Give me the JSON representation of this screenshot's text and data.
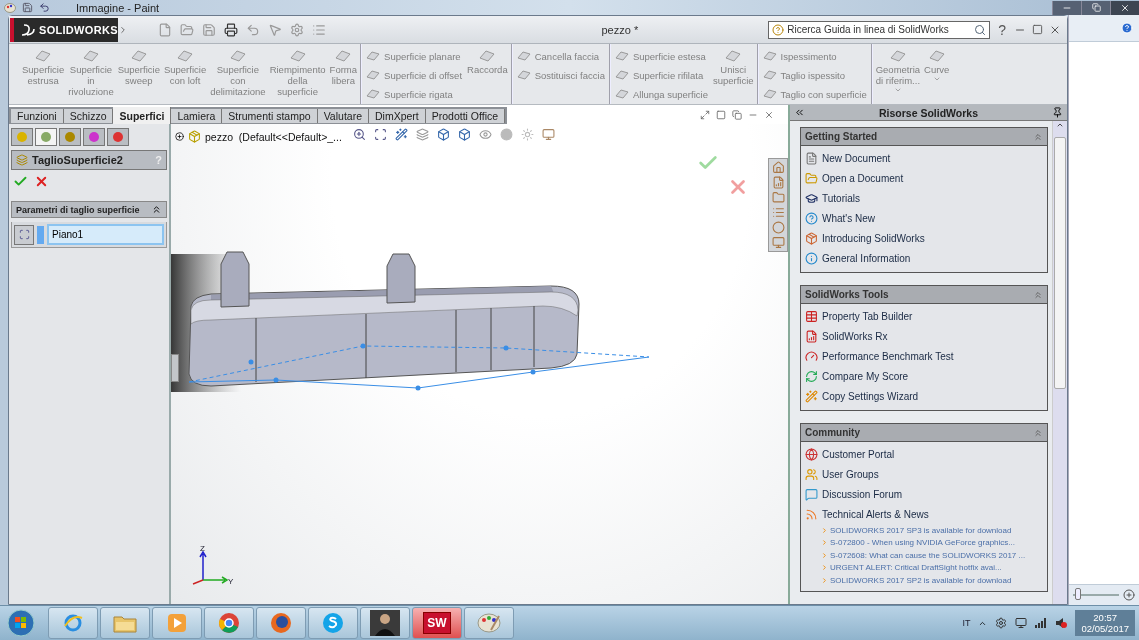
{
  "paint_window": {
    "title": "Immagine - Paint",
    "zoom_slider": {
      "level": 0.05
    }
  },
  "solidworks": {
    "logo": "SOLIDWORKS",
    "document_title": "pezzo *",
    "search": {
      "placeholder": "Ricerca Guida in linea di SolidWorks"
    },
    "help": "?"
  },
  "ribbon": [
    [
      {
        "kind": "large",
        "label": "Superficie\nestrusa"
      },
      {
        "kind": "large",
        "label": "Superficie\nin\nrivoluzione"
      },
      {
        "kind": "large",
        "label": "Superficie\nsweep"
      },
      {
        "kind": "large",
        "label": "Superficie\ncon loft"
      },
      {
        "kind": "large",
        "label": "Superficie\ncon\ndelimitazione"
      },
      {
        "kind": "large",
        "label": "Riempimento\ndella\nsuperficie"
      },
      {
        "kind": "large",
        "label": "Forma\nlibera"
      }
    ],
    [
      {
        "kind": "stack",
        "items": [
          "Superficie planare",
          "Superficie di offset",
          "Superficie rigata"
        ]
      },
      {
        "kind": "large",
        "label": "Raccorda"
      }
    ],
    [
      {
        "kind": "stack",
        "items": [
          "Cancella faccia",
          "Sostituisci faccia"
        ]
      }
    ],
    [
      {
        "kind": "stack",
        "items": [
          "Superficie estesa",
          "Superficie rifilata",
          "Allunga superficie"
        ]
      },
      {
        "kind": "large",
        "label": "Unisci\nsuperficie"
      }
    ],
    [
      {
        "kind": "stack",
        "items": [
          "Ispessimento",
          "Taglio ispessito",
          "Taglio con superficie"
        ]
      }
    ],
    [
      {
        "kind": "large",
        "label": "Geometria\ndi riferim...",
        "dropdown": true
      },
      {
        "kind": "large",
        "label": "Curve",
        "dropdown": true
      }
    ]
  ],
  "command_tabs": [
    {
      "label": "Funzioni",
      "selected": false
    },
    {
      "label": "Schizzo",
      "selected": false
    },
    {
      "label": "Superfici",
      "selected": true
    },
    {
      "label": "Lamiera",
      "selected": false
    },
    {
      "label": "Strumenti stampo",
      "selected": false
    },
    {
      "label": "Valutare",
      "selected": false
    },
    {
      "label": "DimXpert",
      "selected": false
    },
    {
      "label": "Prodotti Office",
      "selected": false
    }
  ],
  "property_manager": {
    "tabs": [
      {
        "selected": false
      },
      {
        "selected": true
      },
      {
        "selected": false
      },
      {
        "selected": false
      },
      {
        "selected": false
      }
    ],
    "title": "TaglioSuperficie2",
    "help": "?",
    "section": {
      "title": "Parametri di taglio superficie",
      "expanded": true,
      "field": "Piano1"
    }
  },
  "viewport": {
    "tree_root": "pezzo  (Default<<Default>_...",
    "triad": {
      "z": "Z",
      "y": "Y"
    }
  },
  "task_pane": {
    "title": "Risorse SolidWorks",
    "sections": [
      {
        "title": "Getting Started",
        "expanded": true,
        "items": [
          "New Document",
          "Open a Document",
          "Tutorials",
          "What's New",
          "Introducing SolidWorks",
          "General Information"
        ]
      },
      {
        "title": "SolidWorks Tools",
        "expanded": true,
        "items": [
          "Property Tab Builder",
          "SolidWorks Rx",
          "Performance Benchmark Test",
          "Compare My Score",
          "Copy Settings Wizard"
        ]
      },
      {
        "title": "Community",
        "expanded": true,
        "items": [
          "Customer Portal",
          "User Groups",
          "Discussion Forum",
          "Technical Alerts & News"
        ],
        "links": [
          "SOLIDWORKS 2017 SP3 is available for download",
          "S-072800 - When using NVIDIA GeForce graphics...",
          "S-072608: What can cause the SOLIDWORKS 2017 ...",
          "URGENT ALERT: Critical DraftSight hotfix avai...",
          "SOLIDWORKS 2017 SP2 is available for download"
        ]
      }
    ]
  },
  "taskbar": {
    "apps": [
      {
        "kind": "ie"
      },
      {
        "kind": "explorer"
      },
      {
        "kind": "media"
      },
      {
        "kind": "chrome"
      },
      {
        "kind": "firefox"
      },
      {
        "kind": "skype"
      },
      {
        "kind": "game"
      },
      {
        "kind": "solidworks",
        "label": "SW"
      },
      {
        "kind": "paint"
      }
    ],
    "language": "IT",
    "time": "20:57",
    "date": "02/05/2017"
  }
}
